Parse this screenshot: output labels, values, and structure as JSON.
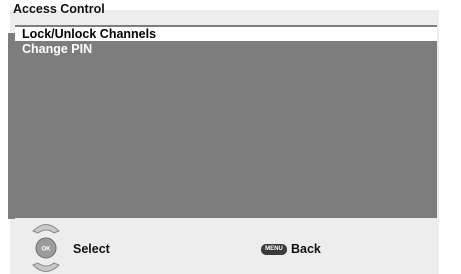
{
  "header": {
    "title": "Access Control"
  },
  "menu": {
    "items": [
      {
        "label": "Lock/Unlock Channels",
        "selected": true
      },
      {
        "label": "Change PIN",
        "selected": false
      }
    ]
  },
  "footer": {
    "ok_icon_label": "OK",
    "select_label": "Select",
    "menu_icon_label": "MENU",
    "back_label": "Back"
  }
}
